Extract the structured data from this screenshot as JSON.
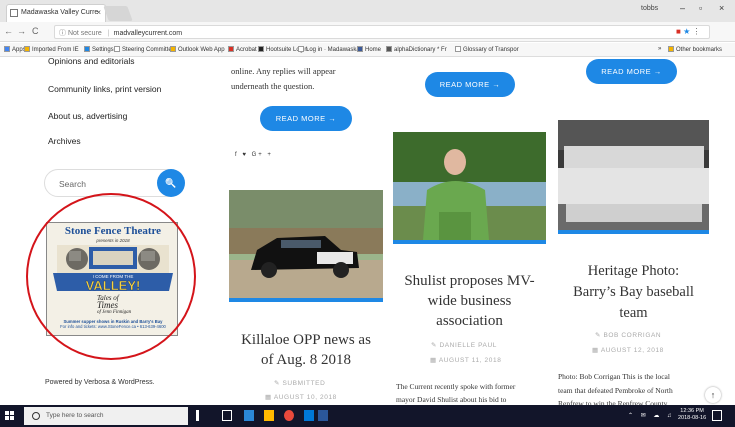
{
  "browser": {
    "tab_title": "Madawaska Valley Curre",
    "tab_close": "×",
    "user": "tobbs",
    "win_min": "–",
    "win_max": "▫",
    "win_close": "×",
    "back": "←",
    "forward": "→",
    "reload": "C",
    "security": "ⓘ Not secure",
    "separator": "|",
    "url": "madvalleycurrent.com",
    "bookmarks_more": "»",
    "bookmarks": [
      {
        "label": "Apps",
        "color": "#4285f4"
      },
      {
        "label": "Imported From IE",
        "color": "#f4b400"
      },
      {
        "label": "Settings",
        "color": "#1e88e5"
      },
      {
        "label": "Steering Committee",
        "color": "#ffffff"
      },
      {
        "label": "Outlook Web App",
        "color": "#f4b400"
      },
      {
        "label": "Acrobat",
        "color": "#d93025"
      },
      {
        "label": "Hootsuite Login",
        "color": "#222222"
      },
      {
        "label": "Log in · Madawaska",
        "color": "#ffffff"
      },
      {
        "label": "Home",
        "color": "#3b5998"
      },
      {
        "label": "alphaDictionary * Fr",
        "color": "#555555"
      },
      {
        "label": "Glossary of Transpor",
        "color": "#ffffff"
      },
      {
        "label": "Other bookmarks",
        "color": "#f4b400"
      }
    ]
  },
  "sidebar": {
    "links": [
      "Opinions and editorials",
      "Community links, print version",
      "About us, advertising",
      "Archives"
    ],
    "search_placeholder": "Search",
    "search_icon": "🔍",
    "ad": {
      "title": "Stone Fence Theatre",
      "presents": "presents in 2018",
      "banner_line1": "I COME FROM THE",
      "banner_line2": "VALLEY!",
      "tales_line1": "Tales of",
      "tales_line2": "Times",
      "tales_line3": "of Jenn Finnigan",
      "bottom_line1": "Summer supper shows in Ruskin and Barry's Bay",
      "bottom_line2": "For info and tickets: www.StoneFence.ca • 613-639-4600"
    },
    "powered_by": "Powered by Verbosa & WordPress."
  },
  "column1": {
    "intro_line1": "online. Any replies will appear",
    "intro_line2": "underneath the question.",
    "read_more": "READ MORE →",
    "share": "f ♥ G+ +",
    "article": {
      "title_line1": "Killaloe OPP news as",
      "title_line2": "of Aug. 8 2018",
      "author_icon": "✎",
      "author": "SUBMITTED",
      "date_icon": "▦",
      "date": "AUGUST 10, 2018"
    }
  },
  "column2": {
    "read_more": "READ MORE →",
    "article": {
      "title_line1": "Shulist proposes MV-",
      "title_line2": "wide business",
      "title_line3": "association",
      "author_icon": "✎",
      "author": "DANIELLE PAUL",
      "date_icon": "▦",
      "date": "AUGUST 11, 2018",
      "excerpt_line1": "The Current recently spoke with former",
      "excerpt_line2": "mayor David Shulist about his bid to"
    }
  },
  "column3": {
    "read_more": "READ MORE →",
    "article": {
      "title_line1": "Heritage Photo:",
      "title_line2": "Barry’s Bay baseball",
      "title_line3": "team",
      "author_icon": "✎",
      "author": "BOB CORRIGAN",
      "date_icon": "▦",
      "date": "AUGUST 12, 2018",
      "excerpt_line1": "Photo: Bob Corrigan This is the local",
      "excerpt_line2": "team that defeated Pembroke of North",
      "excerpt_line3": "Renfrew to win the Renfrew County"
    }
  },
  "scroll_top": "↑",
  "taskbar": {
    "search_placeholder": "Type here to search",
    "tray": "⌃ ✉ ☁ ♫",
    "time": "12:36 PM",
    "date": "2018-08-16"
  }
}
